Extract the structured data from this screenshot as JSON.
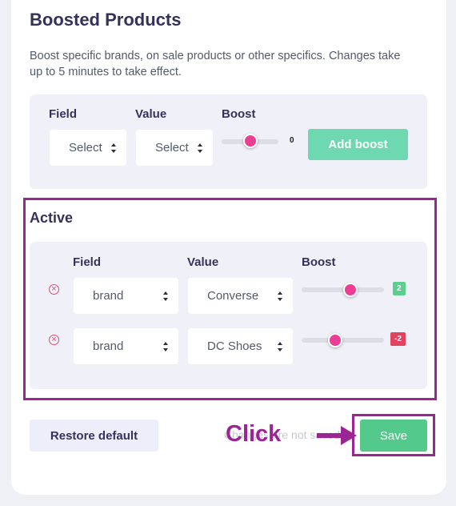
{
  "section": {
    "title": "Boosted Products",
    "description": "Boost specific brands, on sale products or other specifics. Changes take up to 5 minutes to take effect."
  },
  "new_boost": {
    "field_label": "Field",
    "value_label": "Value",
    "boost_label": "Boost",
    "field_placeholder": "Select field",
    "value_placeholder": "Select value",
    "boost_value": "0",
    "add_label": "Add boost"
  },
  "active": {
    "title": "Active",
    "field_label": "Field",
    "value_label": "Value",
    "boost_label": "Boost",
    "rows": [
      {
        "field": "brand",
        "value": "Converse",
        "boost": "2",
        "boost_color": "#5ccf8f"
      },
      {
        "field": "brand",
        "value": "DC Shoes",
        "boost": "-2",
        "boost_color": "#e3435f"
      }
    ]
  },
  "footer": {
    "restore_label": "Restore default",
    "unsaved_text": "Changes are not saved",
    "save_label": "Save"
  },
  "annotation": {
    "callout": "Click",
    "color": "#9b2693"
  },
  "icons": {
    "remove": "circle-x-icon",
    "select": "up-down-caret-icon"
  }
}
